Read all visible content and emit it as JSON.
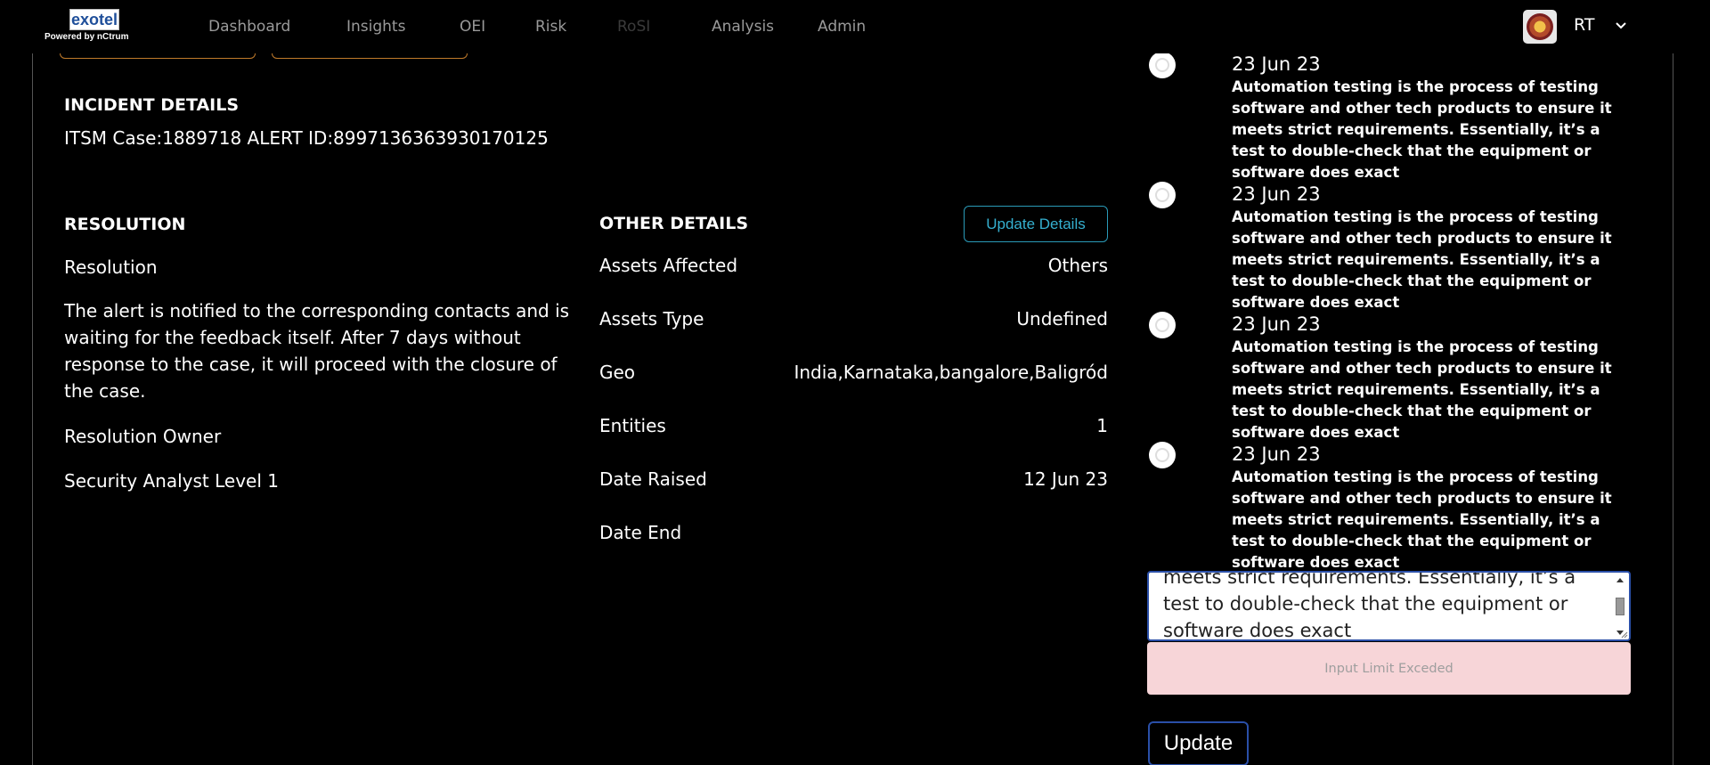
{
  "brand": {
    "logo_text": "exotel",
    "powered_by": "Powered by nCtrum"
  },
  "nav": {
    "items": [
      {
        "label": "Dashboard",
        "enabled": true
      },
      {
        "label": "Insights",
        "enabled": true
      },
      {
        "label": "OEI",
        "enabled": true
      },
      {
        "label": "Risk",
        "enabled": true
      },
      {
        "label": "RoSI",
        "enabled": false
      },
      {
        "label": "Analysis",
        "enabled": true
      },
      {
        "label": "Admin",
        "enabled": true
      }
    ]
  },
  "user": {
    "initials": "RT"
  },
  "incident": {
    "heading": "INCIDENT DETAILS",
    "summary": "ITSM Case:1889718 ALERT ID:8997136363930170125"
  },
  "resolution": {
    "heading": "RESOLUTION",
    "label": "Resolution",
    "text": "The alert is notified to the corresponding contacts and is waiting for the feedback itself. After 7 days without response to the case, it will proceed with the closure of the case.",
    "owner_label": "Resolution Owner",
    "owner_value": "Security Analyst Level 1"
  },
  "other_details": {
    "heading": "OTHER DETAILS",
    "update_button": "Update Details",
    "rows": [
      {
        "label": "Assets Affected",
        "value": "Others"
      },
      {
        "label": "Assets Type",
        "value": "Undefined"
      },
      {
        "label": "Geo",
        "value": "India,Karnataka,bangalore,Baligród"
      },
      {
        "label": "Entities",
        "value": "1"
      },
      {
        "label": "Date Raised",
        "value": "12 Jun 23"
      },
      {
        "label": "Date End",
        "value": ""
      }
    ]
  },
  "timeline": [
    {
      "date": "23 Jun 23",
      "text": "Automation testing is the process of testing software and other tech products to ensure it meets strict requirements. Essentially, it’s a test to double-check that the equipment or software does exact"
    },
    {
      "date": "23 Jun 23",
      "text": "Automation testing is the process of testing software and other tech products to ensure it meets strict requirements. Essentially, it’s a test to double-check that the equipment or software does exact"
    },
    {
      "date": "23 Jun 23",
      "text": "Automation testing is the process of testing software and other tech products to ensure it meets strict requirements. Essentially, it’s a test to double-check that the equipment or software does exact"
    },
    {
      "date": "23 Jun 23",
      "text": "Automation testing is the process of testing software and other tech products to ensure it meets strict requirements. Essentially, it’s a test to double-check that the equipment or software does exact"
    }
  ],
  "comment": {
    "value": "meets strict requirements. Essentially, it’s a test to double-check that the equipment or software does exact",
    "error": "Input Limit Exceded",
    "submit_label": "Update"
  }
}
